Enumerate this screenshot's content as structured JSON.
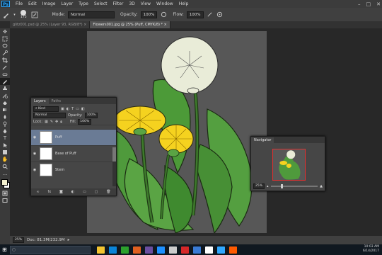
{
  "menubar": {
    "logo": "Ps",
    "items": [
      "File",
      "Edit",
      "Image",
      "Layer",
      "Type",
      "Select",
      "Filter",
      "3D",
      "View",
      "Window",
      "Help"
    ],
    "window_controls": {
      "minimize": "–",
      "maximize": "□",
      "close": "✕"
    }
  },
  "options": {
    "brush_size": "175",
    "mode_label": "Mode:",
    "mode_value": "Normal",
    "opacity_label": "Opacity:",
    "opacity_value": "100%",
    "flow_label": "Flow:",
    "flow_value": "100%"
  },
  "tabs": [
    {
      "label": "glitz001.psd @ 25% (Layer 93, RGB/8*)",
      "close": "×"
    },
    {
      "label": "Flowers001.jpg @ 25% (Puff, CMYK/8) *",
      "close": "×"
    }
  ],
  "status": {
    "zoom": "25%",
    "doc": "Doc: 81.3M/232.9M"
  },
  "layers_panel": {
    "tabs": [
      "Layers",
      "Paths"
    ],
    "kind": "Kind",
    "blend": "Normal",
    "opacity_label": "Opacity:",
    "opacity_value": "100%",
    "lock_label": "Lock:",
    "fill_label": "Fill:",
    "fill_value": "100%",
    "layers": [
      {
        "name": "Puff",
        "selected": true
      },
      {
        "name": "Base of Puff",
        "selected": false
      },
      {
        "name": "Stem",
        "selected": false
      }
    ],
    "footer_icons": [
      "link-icon",
      "fx-icon",
      "mask-icon",
      "adjustment-icon",
      "group-icon",
      "new-layer-icon",
      "trash-icon"
    ]
  },
  "navigator": {
    "title": "Navigator",
    "zoom": "25%"
  },
  "taskbar": {
    "time": "10:03 AM",
    "date": "6/14/2017",
    "icon_colors": [
      "#f4c430",
      "#0a84d8",
      "#2ca02c",
      "#e06020",
      "#6b4ea0",
      "#1e90ff",
      "#cccccc",
      "#d62728",
      "#3a7bd5",
      "#ffffff",
      "#31a8ff",
      "#ff5a00"
    ]
  }
}
